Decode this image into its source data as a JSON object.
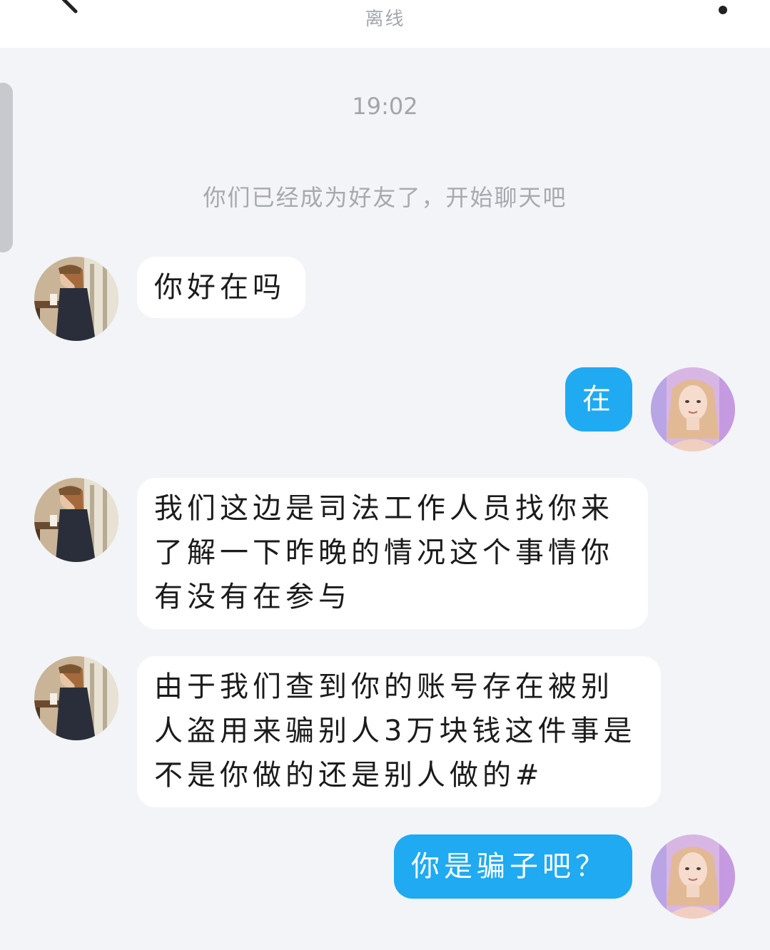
{
  "header": {
    "status": "离线",
    "back_icon": "back-arrow-icon",
    "more_icon": "more-vertical-icon"
  },
  "chat": {
    "timestamp": "19:02",
    "system_note": "你们已经成为好友了，开始聊天吧",
    "messages": [
      {
        "sender": "other",
        "text": "你好在吗"
      },
      {
        "sender": "me",
        "text": "在"
      },
      {
        "sender": "other",
        "text": "我们这边是司法工作人员找你来了解一下昨晚的情况这个事情你有没有在参与"
      },
      {
        "sender": "other",
        "text": "由于我们查到你的账号存在被别人盗用来骗别人3万块钱这件事是不是你做的还是别人做的#"
      },
      {
        "sender": "me",
        "text": "你是骗子吧？"
      }
    ]
  },
  "colors": {
    "background": "#f2f4f7",
    "outgoing_bubble": "#1faaf2",
    "incoming_bubble": "#ffffff"
  }
}
